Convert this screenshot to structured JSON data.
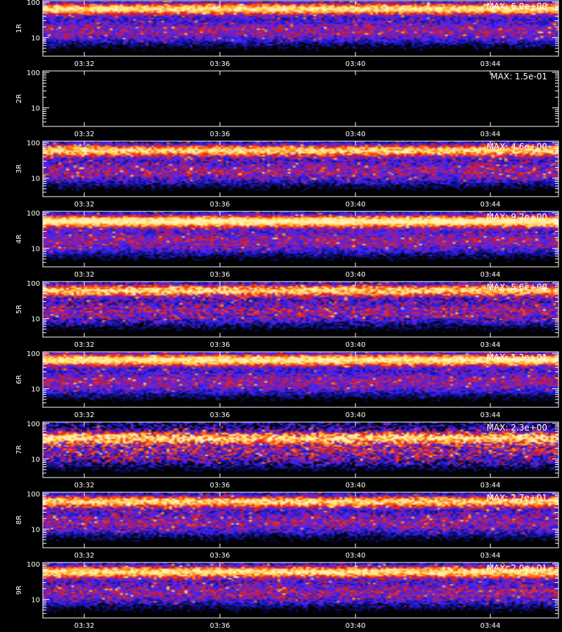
{
  "footer_text": "",
  "palette": {
    "background": "#000000",
    "axis": "#ffffff",
    "colormap": [
      "#000000",
      "#0b0b5a",
      "#1414b4",
      "#3c28ff",
      "#7a1fc8",
      "#c01a3a",
      "#ff3a10",
      "#ff8a20",
      "#ffd24a",
      "#fff2b0"
    ]
  },
  "chart_data": [
    {
      "type": "heatmap",
      "ylabel": "1R",
      "annotation": "MAX: 6.0e+00",
      "x_ticks": [
        "03:32",
        "03:36",
        "03:40",
        "03:44"
      ],
      "y_tick_labels": [
        "100",
        "10"
      ],
      "ylim": [
        3,
        110
      ],
      "y_scale": "log",
      "band_center": 65,
      "band_intensity": 0.85,
      "noise": 0.35,
      "empty": false
    },
    {
      "type": "heatmap",
      "ylabel": "2R",
      "annotation": "MAX: 1.5e-01",
      "x_ticks": [
        "03:32",
        "03:36",
        "03:40",
        "03:44"
      ],
      "y_tick_labels": [
        "100",
        "10"
      ],
      "ylim": [
        3,
        110
      ],
      "y_scale": "log",
      "band_center": 65,
      "band_intensity": 0.0,
      "noise": 0.0,
      "empty": true
    },
    {
      "type": "heatmap",
      "ylabel": "3R",
      "annotation": "MAX: 4.6e+00",
      "x_ticks": [
        "03:32",
        "03:36",
        "03:40",
        "03:44"
      ],
      "y_tick_labels": [
        "100",
        "10"
      ],
      "ylim": [
        3,
        110
      ],
      "y_scale": "log",
      "band_center": 60,
      "band_intensity": 0.8,
      "noise": 0.4,
      "empty": false
    },
    {
      "type": "heatmap",
      "ylabel": "4R",
      "annotation": "MAX: 9.2e+00",
      "x_ticks": [
        "03:32",
        "03:36",
        "03:40",
        "03:44"
      ],
      "y_tick_labels": [
        "100",
        "10"
      ],
      "ylim": [
        3,
        110
      ],
      "y_scale": "log",
      "band_center": 58,
      "band_intensity": 0.95,
      "noise": 0.35,
      "empty": false
    },
    {
      "type": "heatmap",
      "ylabel": "5R",
      "annotation": "MAX: 5.6e+00",
      "x_ticks": [
        "03:32",
        "03:36",
        "03:40",
        "03:44"
      ],
      "y_tick_labels": [
        "100",
        "10"
      ],
      "ylim": [
        3,
        110
      ],
      "y_scale": "log",
      "band_center": 62,
      "band_intensity": 0.8,
      "noise": 0.45,
      "empty": false
    },
    {
      "type": "heatmap",
      "ylabel": "6R",
      "annotation": "MAX: 1.2e+01",
      "x_ticks": [
        "03:32",
        "03:36",
        "03:40",
        "03:44"
      ],
      "y_tick_labels": [
        "100",
        "10"
      ],
      "ylim": [
        3,
        110
      ],
      "y_scale": "log",
      "band_center": 65,
      "band_intensity": 0.9,
      "noise": 0.35,
      "empty": false
    },
    {
      "type": "heatmap",
      "ylabel": "7R",
      "annotation": "MAX: 2.3e+00",
      "x_ticks": [
        "03:32",
        "03:36",
        "03:40",
        "03:44"
      ],
      "y_tick_labels": [
        "100",
        "10"
      ],
      "ylim": [
        3,
        110
      ],
      "y_scale": "log",
      "band_center": 40,
      "band_intensity": 0.75,
      "noise": 0.6,
      "empty": false
    },
    {
      "type": "heatmap",
      "ylabel": "8R",
      "annotation": "MAX: 2.7e+01",
      "x_ticks": [
        "03:32",
        "03:36",
        "03:40",
        "03:44"
      ],
      "y_tick_labels": [
        "100",
        "10"
      ],
      "ylim": [
        3,
        110
      ],
      "y_scale": "log",
      "band_center": 60,
      "band_intensity": 0.8,
      "noise": 0.4,
      "empty": false
    },
    {
      "type": "heatmap",
      "ylabel": "9R",
      "annotation": "MAX: 2.0e+01",
      "x_ticks": [
        "03:32",
        "03:36",
        "03:40",
        "03:44"
      ],
      "y_tick_labels": [
        "100",
        "10"
      ],
      "ylim": [
        3,
        110
      ],
      "y_scale": "log",
      "band_center": 60,
      "band_intensity": 0.85,
      "noise": 0.4,
      "empty": false
    }
  ]
}
